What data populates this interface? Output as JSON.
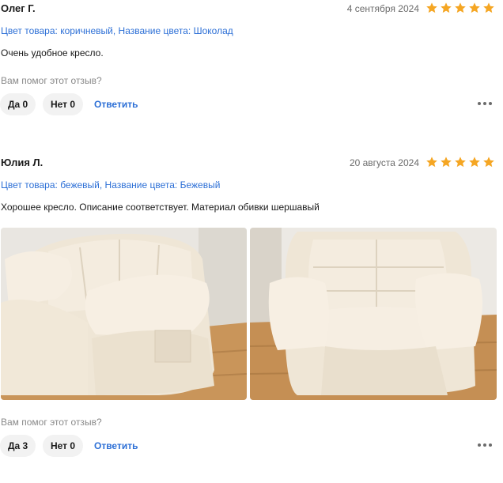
{
  "reviews": [
    {
      "author": "Олег Г.",
      "date": "4 сентября 2024",
      "rating": 5,
      "variant": "Цвет товара: коричневый, Название цвета: Шоколад",
      "text": "Очень удобное кресло.",
      "helpful_question": "Вам помог этот отзыв?",
      "yes_label": "Да 0",
      "no_label": "Нет 0",
      "reply_label": "Ответить"
    },
    {
      "author": "Юлия Л.",
      "date": "20 августа 2024",
      "rating": 5,
      "variant": "Цвет товара: бежевый, Название цвета: Бежевый",
      "text": "Хорошее кресло. Описание соответствует. Материал обивки шершавый",
      "photos": [
        "recliner-armchair-photo",
        "recliner-armchair-photo"
      ],
      "helpful_question": "Вам помог этот отзыв?",
      "yes_label": "Да 3",
      "no_label": "Нет 0",
      "reply_label": "Ответить"
    }
  ],
  "colors": {
    "star": "#f5a623",
    "link": "#2c6fd6",
    "pill_bg": "#f2f2f2",
    "muted": "#8a8a8a"
  },
  "icons": {
    "star": "star-icon",
    "more": "more-dots-icon"
  }
}
